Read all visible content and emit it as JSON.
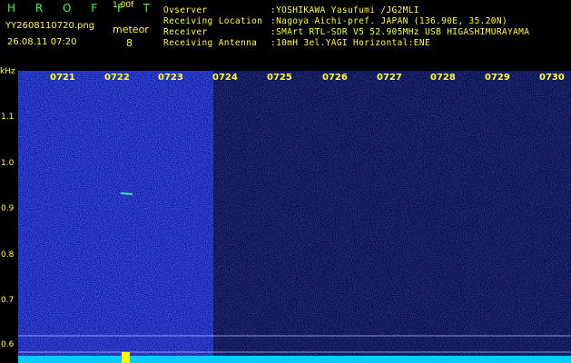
{
  "header": {
    "brand": "H R O F F T",
    "version": "1.00f",
    "filename": "YY2608110720.png",
    "datetime": "26.08.11 07:20",
    "meteor_label": "meteor",
    "meteor_count": "8",
    "info": [
      {
        "key": "Ovserver",
        "value": ":YOSHIKAWA Yasufumi /JG2MLI"
      },
      {
        "key": "Receiving Location",
        "value": ":Nagoya Aichi-pref. JAPAN (136.90E, 35.20N)"
      },
      {
        "key": "Receiver",
        "value": ":SMArt RTL-SDR V5 52.905MHz USB HIGASHIMURAYAMA"
      },
      {
        "key": "Receiving Antenna",
        "value": ":10mH 3el.YAGI Horizontal:ENE"
      }
    ]
  },
  "spectrogram": {
    "y_unit": "kHz",
    "y_ticks": [
      "1.1",
      "1.0",
      "0.9",
      "0.8",
      "0.7",
      "0.6"
    ],
    "x_ticks": [
      "0721",
      "0722",
      "0723",
      "0724",
      "0725",
      "0726",
      "0727",
      "0728",
      "0729",
      "0730"
    ],
    "colors": {
      "background": "#000000",
      "noise_bright": "#2030d0",
      "noise_dim": "#101470",
      "text": "#ffff33",
      "brand": "#33ff33",
      "baseline": "#00ccff",
      "marker": "#ffff00"
    }
  }
}
